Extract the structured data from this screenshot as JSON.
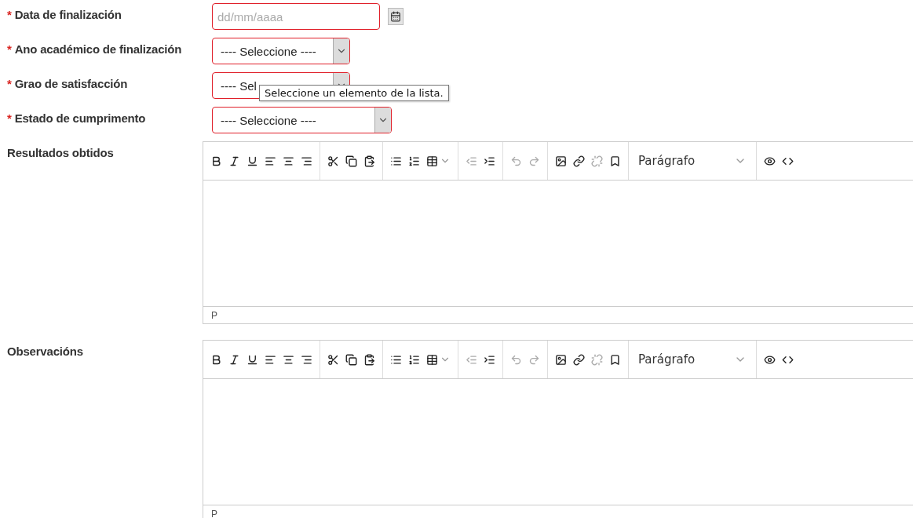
{
  "fields": [
    {
      "label": "Data de finalización",
      "required_mark": "*",
      "kind": "date",
      "placeholder": "dd/mm/aaaa",
      "invalid": true
    },
    {
      "label": "Ano académico de finalización",
      "required_mark": "*",
      "kind": "select",
      "value": "---- Seleccione ----",
      "invalid": true
    },
    {
      "label": "Grao de satisfacción",
      "required_mark": "*",
      "kind": "select",
      "value": "---- Sel",
      "invalid": true,
      "tooltip": "Seleccione un elemento de la lista."
    },
    {
      "label": "Estado de cumprimento",
      "required_mark": "*",
      "kind": "select",
      "value": "---- Seleccione ----",
      "invalid": true
    }
  ],
  "editors": [
    {
      "label": "Resultados obtidos",
      "block_format": "Parágrafo",
      "path": "P"
    },
    {
      "label": "Observacións",
      "block_format": "Parágrafo",
      "path": "P"
    }
  ],
  "toolbar": [
    [
      {
        "kind": "bold",
        "disabled": false
      },
      {
        "kind": "italic",
        "disabled": false
      },
      {
        "kind": "underline",
        "disabled": false
      },
      {
        "kind": "align-left",
        "disabled": false
      },
      {
        "kind": "align-center",
        "disabled": false
      },
      {
        "kind": "align-right",
        "disabled": false
      }
    ],
    [
      {
        "kind": "cut",
        "disabled": false
      },
      {
        "kind": "copy",
        "disabled": false
      },
      {
        "kind": "paste",
        "disabled": false
      }
    ],
    [
      {
        "kind": "bullet-list",
        "disabled": false
      },
      {
        "kind": "numbered-list",
        "disabled": false
      },
      {
        "kind": "table",
        "disabled": false
      }
    ],
    [
      {
        "kind": "outdent",
        "disabled": true
      },
      {
        "kind": "indent",
        "disabled": false
      }
    ],
    [
      {
        "kind": "undo",
        "disabled": true
      },
      {
        "kind": "redo",
        "disabled": true
      }
    ],
    [
      {
        "kind": "image",
        "disabled": false
      },
      {
        "kind": "link",
        "disabled": false
      },
      {
        "kind": "unlink",
        "disabled": true
      },
      {
        "kind": "bookmark",
        "disabled": false
      }
    ],
    [
      {
        "kind": "format",
        "disabled": false
      }
    ],
    [
      {
        "kind": "preview",
        "disabled": false
      },
      {
        "kind": "source",
        "disabled": false
      }
    ]
  ]
}
